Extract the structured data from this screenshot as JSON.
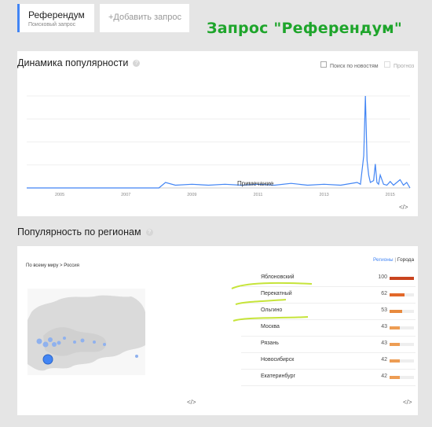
{
  "search": {
    "term": "Референдум",
    "term_type": "Поисковый запрос",
    "add_placeholder": "+Добавить запрос"
  },
  "headline": "Запрос \"Референдум\"",
  "interest_over_time": {
    "title": "Динамика популярности",
    "help_icon": "?",
    "news_headlines_label": "Поиск по новостям",
    "forecast_label": "Прогноз",
    "note_label": "Примечание",
    "embed_label": "</>"
  },
  "chart_data": {
    "type": "line",
    "title": "",
    "xlabel": "",
    "ylabel": "",
    "x_ticks": [
      "2005",
      "2007",
      "2009",
      "2011",
      "2013",
      "2015"
    ],
    "x": [
      2004.0,
      2006.0,
      2008.0,
      2008.2,
      2008.5,
      2009.0,
      2009.5,
      2010.0,
      2010.5,
      2011.0,
      2011.5,
      2012.0,
      2012.5,
      2013.0,
      2013.5,
      2014.0,
      2014.1,
      2014.2,
      2014.25,
      2014.3,
      2014.35,
      2014.4,
      2014.5,
      2014.55,
      2014.6,
      2014.65,
      2014.7,
      2014.8,
      2014.9,
      2015.0,
      2015.1,
      2015.3,
      2015.4,
      2015.5,
      2015.6
    ],
    "series": [
      {
        "values": [
          0,
          0,
          0,
          6,
          3,
          4,
          3,
          4,
          3,
          4,
          3,
          5,
          3,
          4,
          3,
          6,
          4,
          35,
          100,
          30,
          14,
          6,
          8,
          26,
          6,
          4,
          14,
          4,
          3,
          7,
          3,
          9,
          3,
          6,
          0
        ]
      }
    ],
    "ylim": [
      0,
      100
    ],
    "xlim": [
      2004,
      2015.6
    ],
    "grid": true,
    "color": "#4285f4"
  },
  "interest_by_region": {
    "title": "Популярность по регионам",
    "help_icon": "?",
    "breadcrumb": "По всему миру > Россия",
    "tab_regions": "Регионы",
    "tab_separator": "|",
    "tab_cities": "Города",
    "embed_label": "</>",
    "map_embed_label": "</>",
    "rows": [
      {
        "name": "Яблоновский",
        "value": "100",
        "fraction": 1.0,
        "color": "#c9441f"
      },
      {
        "name": "Перекатный",
        "value": "62",
        "fraction": 0.62,
        "color": "#e2682a"
      },
      {
        "name": "Ольгино",
        "value": "53",
        "fraction": 0.53,
        "color": "#e88a3e"
      },
      {
        "name": "Москва",
        "value": "43",
        "fraction": 0.43,
        "color": "#ed9d54"
      },
      {
        "name": "Рязань",
        "value": "43",
        "fraction": 0.43,
        "color": "#ed9d54"
      },
      {
        "name": "Новосибирск",
        "value": "42",
        "fraction": 0.42,
        "color": "#ed9d54"
      },
      {
        "name": "Екатеринбург",
        "value": "42",
        "fraction": 0.42,
        "color": "#ed9d54"
      }
    ]
  },
  "colors": {
    "accent_blue": "#4285f4",
    "headline_green": "#1ea52b",
    "annotation_green": "#c6e43a"
  }
}
